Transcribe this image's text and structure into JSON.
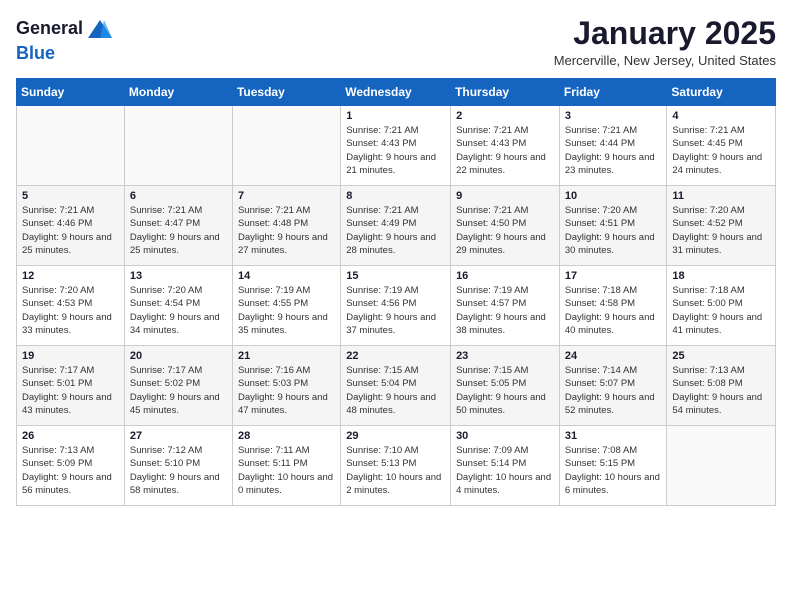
{
  "header": {
    "logo_general": "General",
    "logo_blue": "Blue",
    "month": "January 2025",
    "location": "Mercerville, New Jersey, United States"
  },
  "weekdays": [
    "Sunday",
    "Monday",
    "Tuesday",
    "Wednesday",
    "Thursday",
    "Friday",
    "Saturday"
  ],
  "weeks": [
    [
      {
        "day": "",
        "sunrise": "",
        "sunset": "",
        "daylight": ""
      },
      {
        "day": "",
        "sunrise": "",
        "sunset": "",
        "daylight": ""
      },
      {
        "day": "",
        "sunrise": "",
        "sunset": "",
        "daylight": ""
      },
      {
        "day": "1",
        "sunrise": "Sunrise: 7:21 AM",
        "sunset": "Sunset: 4:43 PM",
        "daylight": "Daylight: 9 hours and 21 minutes."
      },
      {
        "day": "2",
        "sunrise": "Sunrise: 7:21 AM",
        "sunset": "Sunset: 4:43 PM",
        "daylight": "Daylight: 9 hours and 22 minutes."
      },
      {
        "day": "3",
        "sunrise": "Sunrise: 7:21 AM",
        "sunset": "Sunset: 4:44 PM",
        "daylight": "Daylight: 9 hours and 23 minutes."
      },
      {
        "day": "4",
        "sunrise": "Sunrise: 7:21 AM",
        "sunset": "Sunset: 4:45 PM",
        "daylight": "Daylight: 9 hours and 24 minutes."
      }
    ],
    [
      {
        "day": "5",
        "sunrise": "Sunrise: 7:21 AM",
        "sunset": "Sunset: 4:46 PM",
        "daylight": "Daylight: 9 hours and 25 minutes."
      },
      {
        "day": "6",
        "sunrise": "Sunrise: 7:21 AM",
        "sunset": "Sunset: 4:47 PM",
        "daylight": "Daylight: 9 hours and 25 minutes."
      },
      {
        "day": "7",
        "sunrise": "Sunrise: 7:21 AM",
        "sunset": "Sunset: 4:48 PM",
        "daylight": "Daylight: 9 hours and 27 minutes."
      },
      {
        "day": "8",
        "sunrise": "Sunrise: 7:21 AM",
        "sunset": "Sunset: 4:49 PM",
        "daylight": "Daylight: 9 hours and 28 minutes."
      },
      {
        "day": "9",
        "sunrise": "Sunrise: 7:21 AM",
        "sunset": "Sunset: 4:50 PM",
        "daylight": "Daylight: 9 hours and 29 minutes."
      },
      {
        "day": "10",
        "sunrise": "Sunrise: 7:20 AM",
        "sunset": "Sunset: 4:51 PM",
        "daylight": "Daylight: 9 hours and 30 minutes."
      },
      {
        "day": "11",
        "sunrise": "Sunrise: 7:20 AM",
        "sunset": "Sunset: 4:52 PM",
        "daylight": "Daylight: 9 hours and 31 minutes."
      }
    ],
    [
      {
        "day": "12",
        "sunrise": "Sunrise: 7:20 AM",
        "sunset": "Sunset: 4:53 PM",
        "daylight": "Daylight: 9 hours and 33 minutes."
      },
      {
        "day": "13",
        "sunrise": "Sunrise: 7:20 AM",
        "sunset": "Sunset: 4:54 PM",
        "daylight": "Daylight: 9 hours and 34 minutes."
      },
      {
        "day": "14",
        "sunrise": "Sunrise: 7:19 AM",
        "sunset": "Sunset: 4:55 PM",
        "daylight": "Daylight: 9 hours and 35 minutes."
      },
      {
        "day": "15",
        "sunrise": "Sunrise: 7:19 AM",
        "sunset": "Sunset: 4:56 PM",
        "daylight": "Daylight: 9 hours and 37 minutes."
      },
      {
        "day": "16",
        "sunrise": "Sunrise: 7:19 AM",
        "sunset": "Sunset: 4:57 PM",
        "daylight": "Daylight: 9 hours and 38 minutes."
      },
      {
        "day": "17",
        "sunrise": "Sunrise: 7:18 AM",
        "sunset": "Sunset: 4:58 PM",
        "daylight": "Daylight: 9 hours and 40 minutes."
      },
      {
        "day": "18",
        "sunrise": "Sunrise: 7:18 AM",
        "sunset": "Sunset: 5:00 PM",
        "daylight": "Daylight: 9 hours and 41 minutes."
      }
    ],
    [
      {
        "day": "19",
        "sunrise": "Sunrise: 7:17 AM",
        "sunset": "Sunset: 5:01 PM",
        "daylight": "Daylight: 9 hours and 43 minutes."
      },
      {
        "day": "20",
        "sunrise": "Sunrise: 7:17 AM",
        "sunset": "Sunset: 5:02 PM",
        "daylight": "Daylight: 9 hours and 45 minutes."
      },
      {
        "day": "21",
        "sunrise": "Sunrise: 7:16 AM",
        "sunset": "Sunset: 5:03 PM",
        "daylight": "Daylight: 9 hours and 47 minutes."
      },
      {
        "day": "22",
        "sunrise": "Sunrise: 7:15 AM",
        "sunset": "Sunset: 5:04 PM",
        "daylight": "Daylight: 9 hours and 48 minutes."
      },
      {
        "day": "23",
        "sunrise": "Sunrise: 7:15 AM",
        "sunset": "Sunset: 5:05 PM",
        "daylight": "Daylight: 9 hours and 50 minutes."
      },
      {
        "day": "24",
        "sunrise": "Sunrise: 7:14 AM",
        "sunset": "Sunset: 5:07 PM",
        "daylight": "Daylight: 9 hours and 52 minutes."
      },
      {
        "day": "25",
        "sunrise": "Sunrise: 7:13 AM",
        "sunset": "Sunset: 5:08 PM",
        "daylight": "Daylight: 9 hours and 54 minutes."
      }
    ],
    [
      {
        "day": "26",
        "sunrise": "Sunrise: 7:13 AM",
        "sunset": "Sunset: 5:09 PM",
        "daylight": "Daylight: 9 hours and 56 minutes."
      },
      {
        "day": "27",
        "sunrise": "Sunrise: 7:12 AM",
        "sunset": "Sunset: 5:10 PM",
        "daylight": "Daylight: 9 hours and 58 minutes."
      },
      {
        "day": "28",
        "sunrise": "Sunrise: 7:11 AM",
        "sunset": "Sunset: 5:11 PM",
        "daylight": "Daylight: 10 hours and 0 minutes."
      },
      {
        "day": "29",
        "sunrise": "Sunrise: 7:10 AM",
        "sunset": "Sunset: 5:13 PM",
        "daylight": "Daylight: 10 hours and 2 minutes."
      },
      {
        "day": "30",
        "sunrise": "Sunrise: 7:09 AM",
        "sunset": "Sunset: 5:14 PM",
        "daylight": "Daylight: 10 hours and 4 minutes."
      },
      {
        "day": "31",
        "sunrise": "Sunrise: 7:08 AM",
        "sunset": "Sunset: 5:15 PM",
        "daylight": "Daylight: 10 hours and 6 minutes."
      },
      {
        "day": "",
        "sunrise": "",
        "sunset": "",
        "daylight": ""
      }
    ]
  ]
}
